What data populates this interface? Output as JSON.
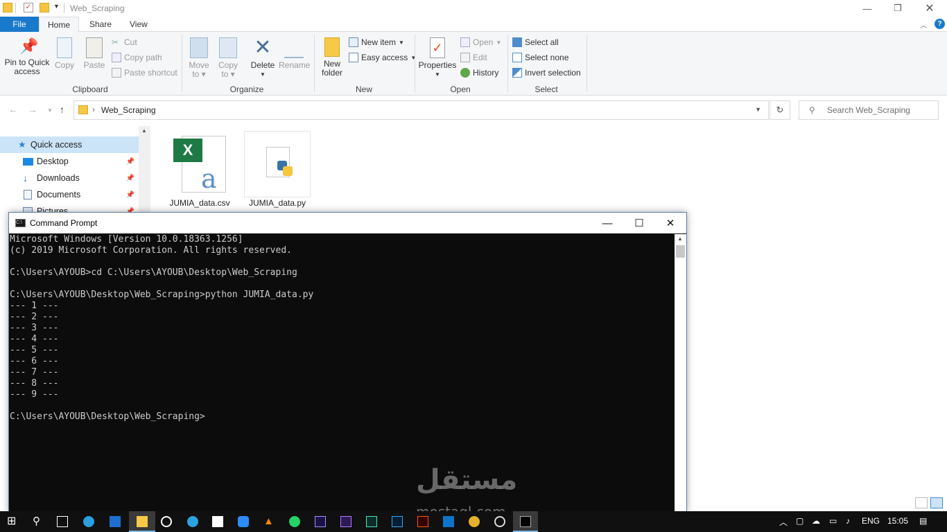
{
  "window": {
    "title": "Web_Scraping"
  },
  "tabs": [
    "File",
    "Home",
    "Share",
    "View"
  ],
  "ribbon": {
    "clipboard": {
      "label": "Clipboard",
      "pin": "Pin to Quick\naccess",
      "pin_l1": "Pin to Quick",
      "pin_l2": "access",
      "copy": "Copy",
      "paste": "Paste",
      "cut": "Cut",
      "copy_path": "Copy path",
      "paste_shortcut": "Paste shortcut"
    },
    "organize": {
      "label": "Organize",
      "move_l1": "Move",
      "move_l2": "to",
      "copy_l1": "Copy",
      "copy_l2": "to",
      "delete": "Delete",
      "rename": "Rename"
    },
    "new": {
      "label": "New",
      "folder_l1": "New",
      "folder_l2": "folder",
      "new_item": "New item",
      "easy_access": "Easy access"
    },
    "open": {
      "label": "Open",
      "properties": "Properties",
      "open": "Open",
      "edit": "Edit",
      "history": "History"
    },
    "select": {
      "label": "Select",
      "select_all": "Select all",
      "select_none": "Select none",
      "invert": "Invert selection"
    }
  },
  "address": {
    "path": "Web_Scraping",
    "search_placeholder": "Search Web_Scraping"
  },
  "nav": {
    "quick_access": "Quick access",
    "items": [
      "Desktop",
      "Downloads",
      "Documents",
      "Pictures"
    ]
  },
  "files": [
    {
      "name": "JUMIA_data.csv",
      "icon": "excel-csv-icon"
    },
    {
      "name": "JUMIA_data.py",
      "icon": "python-file-icon"
    }
  ],
  "cmd": {
    "title": "Command Prompt",
    "output": "Microsoft Windows [Version 10.0.18363.1256]\n(c) 2019 Microsoft Corporation. All rights reserved.\n\nC:\\Users\\AYOUB>cd C:\\Users\\AYOUB\\Desktop\\Web_Scraping\n\nC:\\Users\\AYOUB\\Desktop\\Web_Scraping>python JUMIA_data.py\n--- 1 ---\n--- 2 ---\n--- 3 ---\n--- 4 ---\n--- 5 ---\n--- 6 ---\n--- 7 ---\n--- 8 ---\n--- 9 ---\n\nC:\\Users\\AYOUB\\Desktop\\Web_Scraping>"
  },
  "watermark": {
    "arabic": "مستقل",
    "latin": "mostaql.com"
  },
  "taskbar": {
    "lang": "ENG",
    "time": "15:05"
  },
  "colors": {
    "file_tab": "#1979ca",
    "selection": "#cce4f7",
    "console_bg": "#0c0c0c",
    "taskbar": "#101010"
  }
}
